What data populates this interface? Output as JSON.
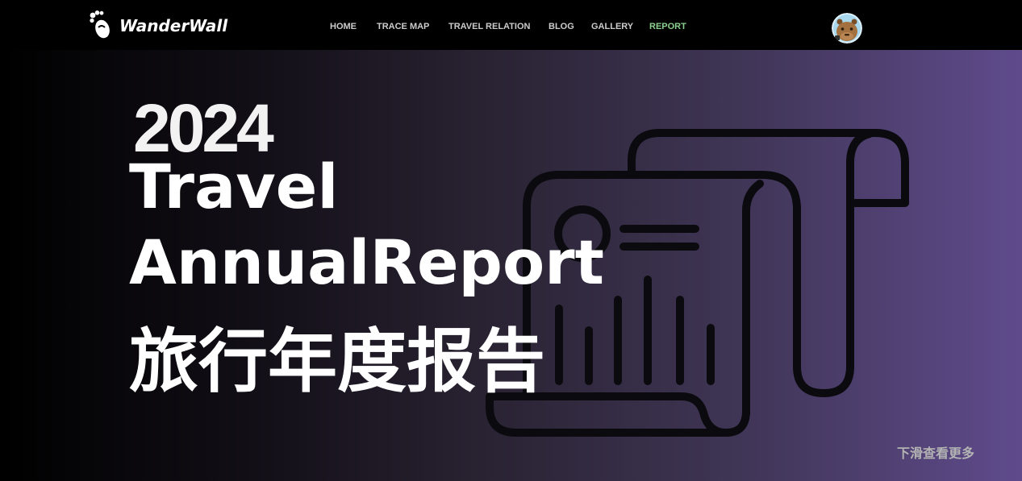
{
  "header": {
    "logo": {
      "text": "WanderWall",
      "icon": "footprint-icon"
    },
    "nav": [
      {
        "label": "HOME"
      },
      {
        "label": "TRACE MAP"
      },
      {
        "label": "TRAVEL RELATION"
      },
      {
        "label": "BLOG"
      },
      {
        "label": "GALLERY"
      },
      {
        "label": "REPORT",
        "active": true
      }
    ],
    "avatar": {
      "icon": "capybara-avatar-icon"
    }
  },
  "hero": {
    "year": "2024",
    "title_en_line1": "Travel",
    "title_en_line2": "AnnualReport",
    "title_cn": "旅行年度报告",
    "illustration": "report-scroll-icon",
    "scroll_hint": "下滑查看更多"
  },
  "colors": {
    "header_bg": "#000000",
    "nav_text": "#cccccc",
    "active_nav": "#8ccf8e",
    "hero_gradient_start": "#000000",
    "hero_gradient_end": "#5f4b8c",
    "illustration_stroke": "#0b0a0e",
    "scroll_hint": "#b3b3b3"
  }
}
